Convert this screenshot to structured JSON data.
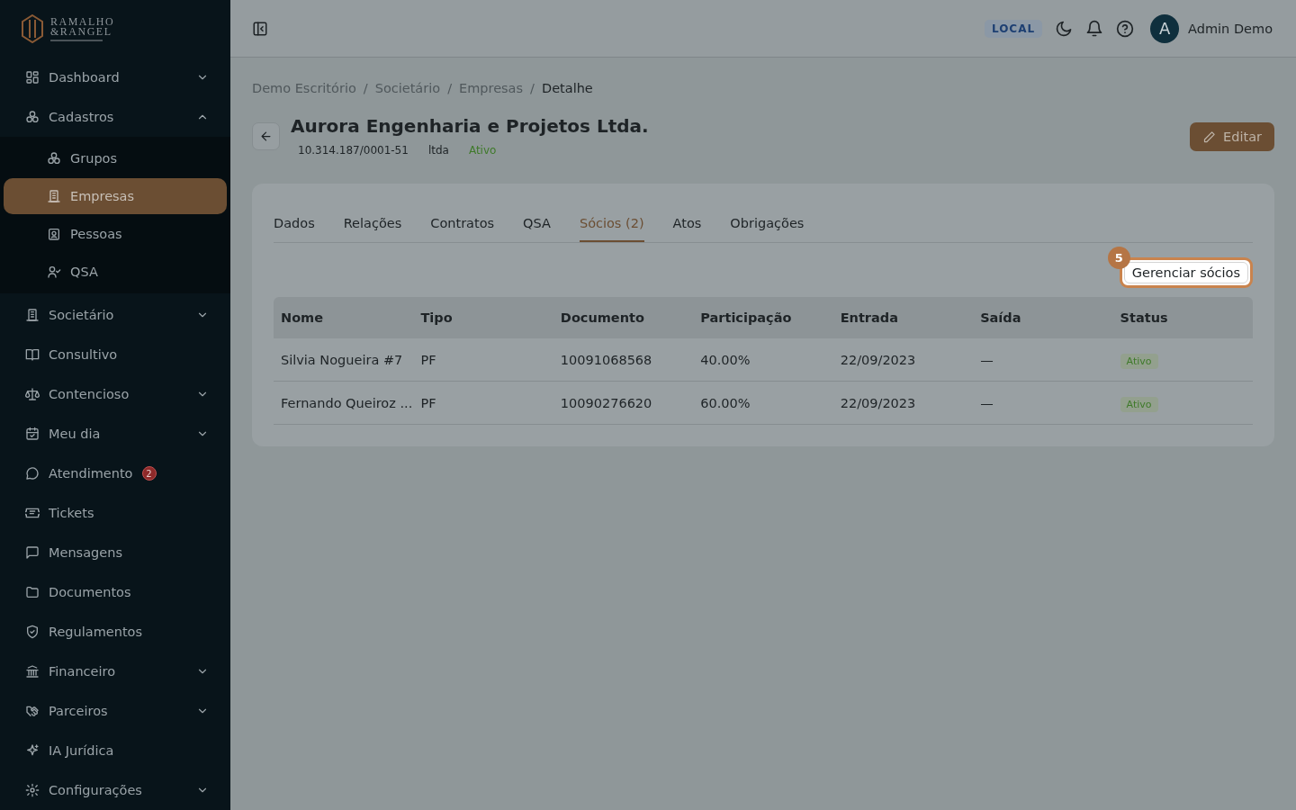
{
  "sidebar": {
    "logo": {
      "line_1": "RAMALHO",
      "line_2": "&RANGEL"
    },
    "items": [
      {
        "label": "Dashboard",
        "kind": "group",
        "selected": false
      },
      {
        "label": "Cadastros",
        "kind": "group",
        "expanded": true,
        "selected": false,
        "children": [
          {
            "label": "Grupos",
            "selected": false
          },
          {
            "label": "Empresas",
            "selected": true
          },
          {
            "label": "Pessoas",
            "selected": false
          },
          {
            "label": "QSA",
            "selected": false
          }
        ]
      },
      {
        "label": "Societário",
        "kind": "group",
        "selected": false
      },
      {
        "label": "Consultivo",
        "kind": "link",
        "selected": false
      },
      {
        "label": "Contencioso",
        "kind": "group",
        "selected": false
      },
      {
        "label": "Meu dia",
        "kind": "group",
        "selected": false
      },
      {
        "label": "Atendimento",
        "kind": "link",
        "selected": false,
        "badge": "2"
      },
      {
        "label": "Tickets",
        "kind": "link",
        "selected": false
      },
      {
        "label": "Mensagens",
        "kind": "link",
        "selected": false
      },
      {
        "label": "Documentos",
        "kind": "link",
        "selected": false
      },
      {
        "label": "Regulamentos",
        "kind": "link",
        "selected": false
      },
      {
        "label": "Financeiro",
        "kind": "group",
        "selected": false
      },
      {
        "label": "Parceiros",
        "kind": "group",
        "selected": false
      },
      {
        "label": "IA Jurídica",
        "kind": "link",
        "selected": false
      },
      {
        "label": "Configurações",
        "kind": "group",
        "selected": false
      }
    ]
  },
  "topbar": {
    "environment": "LOCAL",
    "avatar_initial": "A",
    "user_name": "Admin Demo"
  },
  "breadcrumb": [
    {
      "label": "Demo Escritório",
      "current": false
    },
    {
      "label": "Societário",
      "current": false
    },
    {
      "label": "Empresas",
      "current": false
    },
    {
      "label": "Detalhe",
      "current": true
    }
  ],
  "breadcrumb_separator": "/",
  "company": {
    "name": "Aurora Engenharia e Projetos Ltda.",
    "document": "10.314.187/0001-51",
    "type": "ltda",
    "status": "Ativo"
  },
  "edit_button": "Editar",
  "tabs": [
    {
      "label": "Dados",
      "selected": false
    },
    {
      "label": "Relações",
      "selected": false
    },
    {
      "label": "Contratos",
      "selected": false
    },
    {
      "label": "QSA",
      "selected": false
    },
    {
      "label": "Sócios (2)",
      "selected": true
    },
    {
      "label": "Atos",
      "selected": false
    },
    {
      "label": "Obrigações",
      "selected": false
    }
  ],
  "manage_button": {
    "label": "Gerenciar sócios",
    "tour_step": "5"
  },
  "table": {
    "columns": [
      "Nome",
      "Tipo",
      "Documento",
      "Participação",
      "Entrada",
      "Saída",
      "Status"
    ],
    "rows": [
      [
        "Silvia Nogueira #7",
        "PF",
        "10091068568",
        "40.00%",
        "22/09/2023",
        "—",
        "Ativo"
      ],
      [
        "Fernando Queiroz ...",
        "PF",
        "10090276620",
        "60.00%",
        "22/09/2023",
        "—",
        "Ativo"
      ]
    ]
  }
}
